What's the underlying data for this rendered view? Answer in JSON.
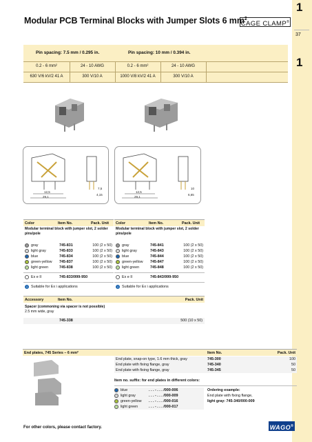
{
  "page_title": "Modular PCB Terminal Blocks with Jumper Slots 6 mm",
  "title_sup": "2",
  "brand_badge": "CAGE CLAMP",
  "brand_sup": "®",
  "tabs": [
    {
      "num": "1",
      "sub": "37"
    },
    {
      "num": "1"
    }
  ],
  "specs": [
    {
      "heading": "Pin spacing: 7.5 mm / 0.295 in.",
      "row1_left": "0.2 - 6 mm²",
      "row1_right": "24 - 10 AWG",
      "row2_left": "630 V/6 kV/2  41 A",
      "row2_right": "300 V/10 A"
    },
    {
      "heading": "Pin spacing: 10 mm / 0.394 in.",
      "row1_left": "0.2 - 6 mm²",
      "row1_right": "24 - 10 AWG",
      "row2_left": "1000 V/8 kV/2  41 A",
      "row2_right": "300 V/10 A"
    }
  ],
  "drawings": [
    {
      "dim_a": "12,5",
      "dim_b": "29,1",
      "dim_c": "7,5",
      "dim_d": "4,15"
    },
    {
      "dim_a": "12,5",
      "dim_b": "29,1",
      "dim_c": "10",
      "dim_d": "6,65"
    }
  ],
  "table": {
    "header": {
      "color": "Color",
      "item_no": "Item No.",
      "pack_unit": "Pack. Unit"
    },
    "columns": [
      {
        "section": "Modular terminal block with jumper slot, 2 solder pins/pole",
        "rows": [
          {
            "color": "gray",
            "item": "745-831",
            "pack": "100 (2 x 50)",
            "swatch": "#9a9a9a"
          },
          {
            "color": "light gray",
            "item": "745-833",
            "pack": "100 (2 x 50)",
            "swatch": "#d6d6d6"
          },
          {
            "color": "blue",
            "item": "745-834",
            "pack": "100 (2 x 50)",
            "swatch": "#1d66b0"
          },
          {
            "color": "green-yellow",
            "item": "745-837",
            "pack": "100 (2 x 50)",
            "swatch": "#a9c23a"
          },
          {
            "color": "light green",
            "item": "745-838",
            "pack": "100 (2 x 50)",
            "swatch": "#bfe0a1"
          }
        ],
        "ex_label": "Ex e II",
        "ex_item": "745-833/999-950",
        "ex_note": "Suitable for Ex i applications"
      },
      {
        "section": "Modular terminal block with jumper slot, 2 solder pins/pole",
        "rows": [
          {
            "color": "gray",
            "item": "745-841",
            "pack": "100 (2 x 50)",
            "swatch": "#9a9a9a"
          },
          {
            "color": "light gray",
            "item": "745-843",
            "pack": "100 (2 x 50)",
            "swatch": "#d6d6d6"
          },
          {
            "color": "blue",
            "item": "745-844",
            "pack": "100 (2 x 50)",
            "swatch": "#1d66b0"
          },
          {
            "color": "green-yellow",
            "item": "745-847",
            "pack": "100 (2 x 50)",
            "swatch": "#a9c23a"
          },
          {
            "color": "light green",
            "item": "745-848",
            "pack": "100 (2 x 50)",
            "swatch": "#bfe0a1"
          }
        ],
        "ex_label": "Ex e II",
        "ex_item": "745-843/999-950",
        "ex_note": "Suitable for Ex i applications"
      }
    ],
    "accessory_header": {
      "label": "Accessory",
      "item_no": "Item No.",
      "pack_unit": "Pack. Unit"
    },
    "spacer_title": "Spacer (commoning via spacer is not possible)",
    "spacer_sub": "2.5 mm wide, gray",
    "spacer_item": "745-338",
    "spacer_pack": "500 (10 x 50)"
  },
  "end_plates": {
    "header": "End plates, 745 Series – 6 mm²",
    "item_no": "Item No.",
    "pack_unit": "Pack. Unit",
    "rows": [
      {
        "desc": "End plate, snap-on type, 1.6 mm thick, gray",
        "item": "745-300",
        "pack": "100"
      },
      {
        "desc": "End plate with fixing flange, gray",
        "item": "745-340",
        "pack": "50"
      },
      {
        "desc": "End plate with fixing flange, gray",
        "item": "745-345",
        "pack": "50"
      }
    ],
    "suffix_title": "Item no. suffix: for end plates in different colors:",
    "suffixes": [
      {
        "color": "blue",
        "code": ". . . - . . . /000-006",
        "swatch": "#1d66b0"
      },
      {
        "color": "light gray",
        "code": ". . . - . . . /000-009",
        "swatch": "#d6d6d6"
      },
      {
        "color": "green-yellow",
        "code": ". . . - . . . /000-016",
        "swatch": "#a9c23a"
      },
      {
        "color": "light green",
        "code": ". . . - . . . /000-017",
        "swatch": "#bfe0a1"
      }
    ],
    "example_title": "Ordering example:",
    "example_line1": "End plate with fixing flange,",
    "example_line2": "light gray: 745-340/000-009"
  },
  "footer_note": "For other colors, please contact factory.",
  "logo_text": "WAGO",
  "logo_sup": "®"
}
